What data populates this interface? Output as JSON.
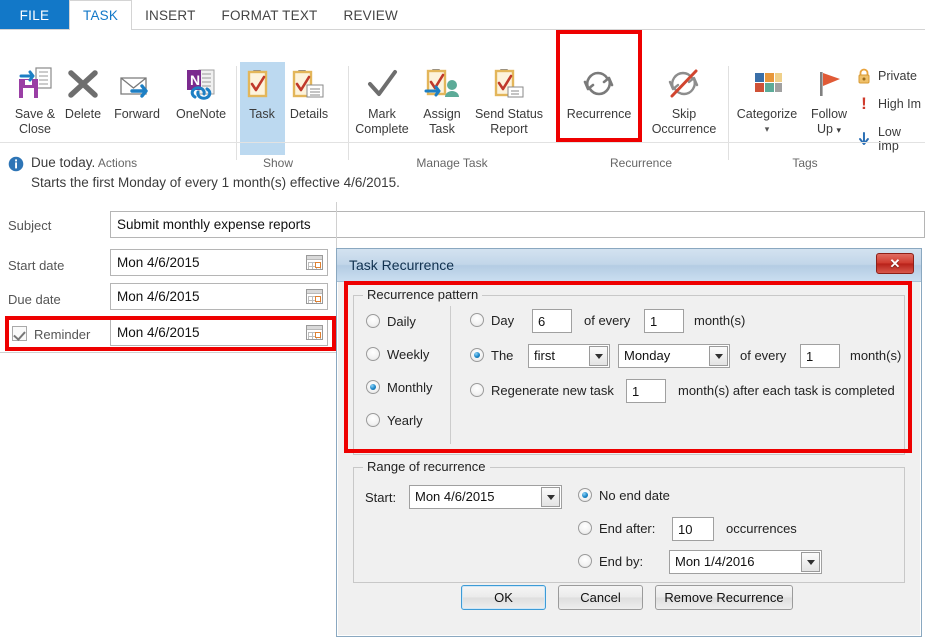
{
  "ribbon": {
    "tabs": [
      {
        "label": "FILE",
        "active": false,
        "file": true
      },
      {
        "label": "TASK",
        "active": true
      },
      {
        "label": "INSERT",
        "active": false
      },
      {
        "label": "FORMAT TEXT",
        "active": false
      },
      {
        "label": "REVIEW",
        "active": false
      }
    ],
    "groups": [
      {
        "label": "Actions"
      },
      {
        "label": "Show"
      },
      {
        "label": "Manage Task"
      },
      {
        "label": "Recurrence"
      },
      {
        "label": "Tags"
      }
    ],
    "buttons": {
      "save_close": "Save &\nClose",
      "save_close_l1": "Save &",
      "save_close_l2": "Close",
      "delete": "Delete",
      "forward": "Forward",
      "onenote": "OneNote",
      "task": "Task",
      "details": "Details",
      "mark_complete_l1": "Mark",
      "mark_complete_l2": "Complete",
      "assign_task_l1": "Assign",
      "assign_task_l2": "Task",
      "send_status_l1": "Send Status",
      "send_status_l2": "Report",
      "recurrence": "Recurrence",
      "skip_l1": "Skip",
      "skip_l2": "Occurrence",
      "categorize": "Categorize",
      "follow_up_l1": "Follow",
      "follow_up_l2": "Up",
      "private": "Private",
      "high_importance": "High Im",
      "low_importance": "Low Imp"
    }
  },
  "infobar": {
    "line1": "Due today.",
    "line2": "Starts the first Monday of every 1 month(s) effective 4/6/2015."
  },
  "form": {
    "subject_label": "Subject",
    "subject_value": "Submit monthly expense reports",
    "start_date_label": "Start date",
    "start_date_value": "Mon 4/6/2015",
    "due_date_label": "Due date",
    "due_date_value": "Mon 4/6/2015",
    "reminder_label": "Reminder",
    "reminder_value": "Mon 4/6/2015"
  },
  "dialog": {
    "title": "Task Recurrence",
    "close_glyph": "✕",
    "pattern": {
      "legend": "Recurrence pattern",
      "options": [
        "Daily",
        "Weekly",
        "Monthly",
        "Yearly"
      ],
      "selected": "Monthly",
      "day_label": "Day",
      "day_value": "6",
      "day_of_every": "of every",
      "day_every_value": "1",
      "day_months": "month(s)",
      "the_label": "The",
      "the_ordinal": "first",
      "the_weekday": "Monday",
      "the_of_every": "of every",
      "the_every_value": "1",
      "the_months": "month(s)",
      "regen_label": "Regenerate new task",
      "regen_value": "1",
      "regen_suffix": "month(s) after each task is completed",
      "selected_sub": "The"
    },
    "range": {
      "legend": "Range of recurrence",
      "start_label": "Start:",
      "start_value": "Mon 4/6/2015",
      "no_end_date": "No end date",
      "end_after": "End after:",
      "end_after_value": "10",
      "occurrences": "occurrences",
      "end_by": "End by:",
      "end_by_value": "Mon 1/4/2016",
      "selected": "No end date"
    },
    "buttons": {
      "ok": "OK",
      "cancel": "Cancel",
      "remove": "Remove Recurrence"
    }
  },
  "colors": {
    "accent": "#1278c8",
    "highlight": "#ee0000",
    "selection": "#bcd9f0"
  }
}
